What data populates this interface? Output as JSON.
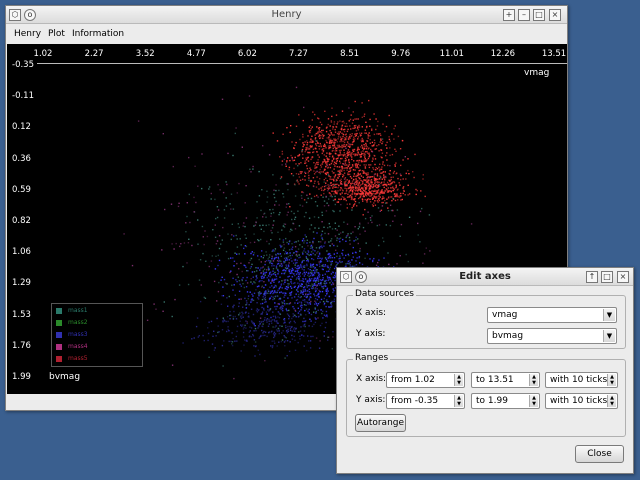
{
  "main_window": {
    "title": "Henry",
    "title_buttons": [
      "+",
      "–",
      "□",
      "×"
    ],
    "menu": [
      "Henry",
      "Plot",
      "Information"
    ]
  },
  "plot": {
    "x_ticks": [
      "1.02",
      "2.27",
      "3.52",
      "4.77",
      "6.02",
      "7.27",
      "8.51",
      "9.76",
      "11.01",
      "12.26",
      "13.51"
    ],
    "y_ticks": [
      "-0.35",
      "-0.11",
      "0.12",
      "0.36",
      "0.59",
      "0.82",
      "1.06",
      "1.29",
      "1.53",
      "1.76",
      "1.99"
    ],
    "x_label": "vmag",
    "y_label": "bvmag",
    "legend": [
      {
        "label": "mass1",
        "color": "#2a7a6a"
      },
      {
        "label": "mass2",
        "color": "#2a8a2a"
      },
      {
        "label": "mass3",
        "color": "#3030b0"
      },
      {
        "label": "mass4",
        "color": "#b03080"
      },
      {
        "label": "mass5",
        "color": "#b02030"
      }
    ]
  },
  "dialog": {
    "title": "Edit axes",
    "data_sources_label": "Data sources",
    "x_axis_label": "X axis:",
    "y_axis_label": "Y axis:",
    "x_source": "vmag",
    "y_source": "bvmag",
    "ranges_label": "Ranges",
    "x_from": "from 1.02",
    "x_to": "to 13.51",
    "x_ticks": "with 10 ticks",
    "y_from": "from -0.35",
    "y_to": "to 1.99",
    "y_ticks": "with 10 ticks",
    "autorange_label": "Autorange",
    "close_label": "Close"
  },
  "colors": {
    "desktop": "#3a5f8f",
    "red_cluster": "#ff3a3a",
    "blue_cluster": "#3a3aff"
  }
}
